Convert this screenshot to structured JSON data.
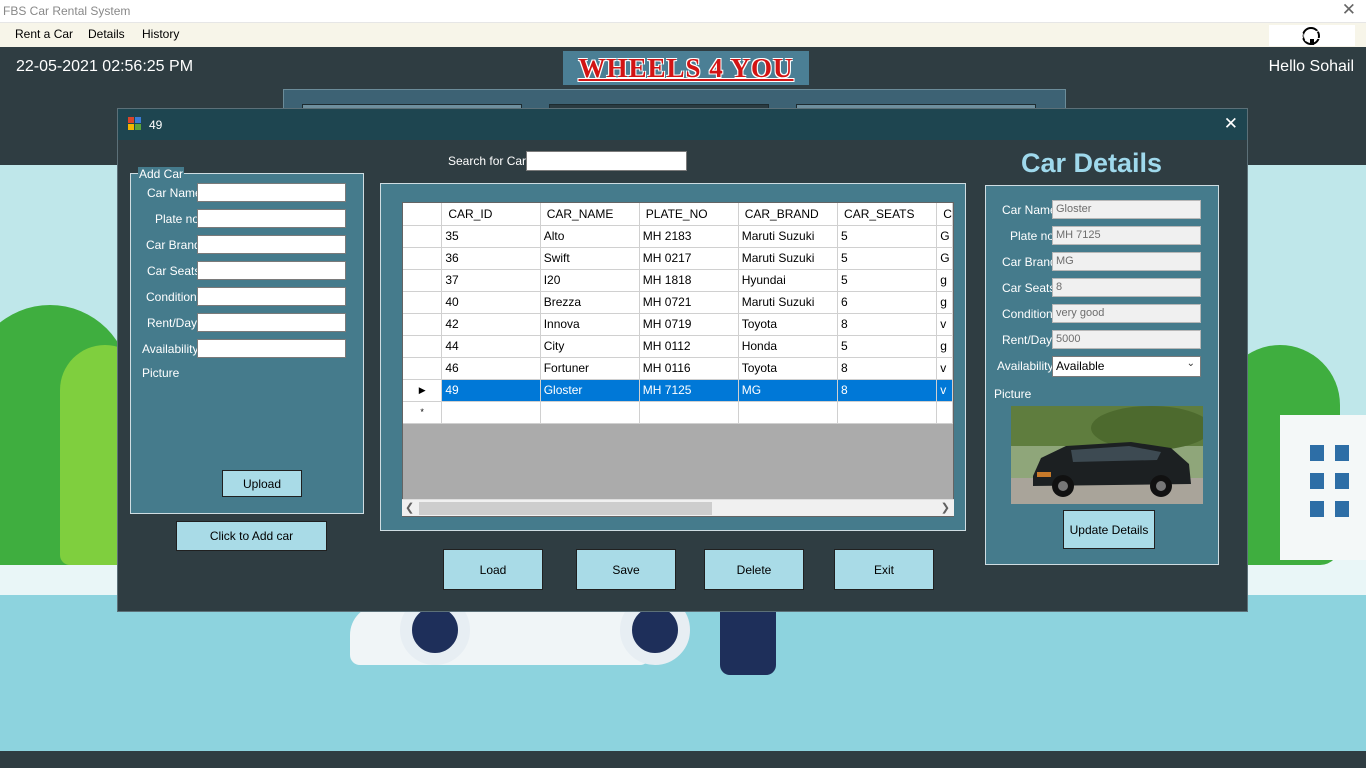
{
  "window": {
    "title": "FBS Car Rental System",
    "close": "✕"
  },
  "menu": {
    "items": [
      "Rent a Car",
      "Details",
      "History"
    ],
    "logout": "Log Out"
  },
  "header": {
    "datetime": "22-05-2021 02:56:25 PM",
    "logo": "WHEELS 4 YOU",
    "greeting": "Hello  Sohail"
  },
  "dialog": {
    "title": "49",
    "close": "✕",
    "add_car": {
      "group_title": "Add Car",
      "labels": {
        "car_name": "Car Name",
        "plate_no": "Plate no",
        "car_brand": "Car Brand",
        "car_seats": "Car Seats",
        "condition": "Condition",
        "rent_day": "Rent/Day",
        "availability": "Availability",
        "picture": "Picture"
      },
      "upload_button": "Upload",
      "add_button": "Click to Add car"
    },
    "search": {
      "label": "Search for Car",
      "value": ""
    },
    "grid": {
      "columns": [
        "CAR_ID",
        "CAR_NAME",
        "PLATE_NO",
        "CAR_BRAND",
        "CAR_SEATS",
        "C"
      ],
      "rows": [
        [
          "35",
          "Alto",
          "MH 2183",
          "Maruti Suzuki",
          "5",
          "G"
        ],
        [
          "36",
          "Swift",
          "MH 0217",
          "Maruti Suzuki",
          "5",
          "G"
        ],
        [
          "37",
          "I20",
          "MH 1818",
          "Hyundai",
          "5",
          "g"
        ],
        [
          "40",
          "Brezza",
          "MH 0721",
          "Maruti Suzuki",
          "6",
          "g"
        ],
        [
          "42",
          "Innova",
          "MH 0719",
          "Toyota",
          "8",
          "v"
        ],
        [
          "44",
          "City",
          "MH 0112",
          "Honda",
          "5",
          "g"
        ],
        [
          "46",
          "Fortuner",
          "MH 0116",
          "Toyota",
          "8",
          "v"
        ],
        [
          "49",
          "Gloster",
          "MH 7125",
          "MG",
          "8",
          "v"
        ]
      ],
      "selected_row_marker": "▶",
      "new_row_marker": "*"
    },
    "actions": {
      "load": "Load",
      "save": "Save",
      "delete": "Delete",
      "exit": "Exit"
    },
    "details": {
      "title": "Car Details",
      "labels": {
        "car_name": "Car Name",
        "plate_no": "Plate no",
        "car_brand": "Car Brand",
        "car_seats": "Car Seats",
        "condition": "Condition",
        "rent_day": "Rent/Day",
        "availability": "Availability",
        "picture": "Picture"
      },
      "values": {
        "car_name": "Gloster",
        "plate_no": "MH 7125",
        "car_brand": "MG",
        "car_seats": "8",
        "condition": "very good",
        "rent_day": "5000",
        "availability": "Available"
      },
      "update_button": "Update Details"
    }
  },
  "colors": {
    "header_bg": "#2f3d42",
    "panel": "#457b8c",
    "button": "#a9dbe7",
    "selection": "#0078d7",
    "logo_text": "#d21414"
  }
}
